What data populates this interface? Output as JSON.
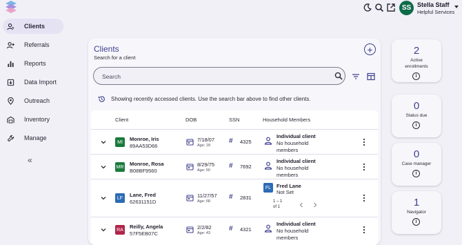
{
  "user": {
    "initials": "SS",
    "name": "Stella Staff",
    "org": "Helpful Services"
  },
  "sidebar": {
    "items": [
      {
        "label": "Clients",
        "icon": "clients-icon",
        "active": true
      },
      {
        "label": "Referrals",
        "icon": "referrals-icon"
      },
      {
        "label": "Reports",
        "icon": "reports-icon"
      },
      {
        "label": "Data Import",
        "icon": "data-import-icon"
      },
      {
        "label": "Outreach",
        "icon": "outreach-icon"
      },
      {
        "label": "Inventory",
        "icon": "inventory-icon"
      },
      {
        "label": "Manage",
        "icon": "manage-icon"
      }
    ],
    "collapse_glyph": "«"
  },
  "main": {
    "title": "Clients",
    "subtitle": "Search for a client",
    "search_placeholder": "Search",
    "notice": "Showing recently accessed clients. Use the search bar above to find other clients.",
    "columns": [
      "Client",
      "DOB",
      "SSN",
      "Household Members"
    ],
    "rows": [
      {
        "initials": "MI",
        "avatar_color": "#1a7a3c",
        "name": "Monroe, Iris",
        "id": "89AA53D66",
        "dob": "7/18/07",
        "age": "Age: 18",
        "ssn": "4325",
        "hh_title": "Individual client",
        "hh_sub1": "No household",
        "hh_sub2": "members"
      },
      {
        "initials": "MR",
        "avatar_color": "#1a7a3c",
        "name": "Monroe, Rosa",
        "id": "B08BF9560",
        "dob": "8/29/75",
        "age": "Age: 50",
        "ssn": "7692",
        "hh_title": "Individual client",
        "hh_sub1": "No household",
        "hh_sub2": "members"
      },
      {
        "initials": "LF",
        "avatar_color": "#2d6bb5",
        "name": "Lane, Fred",
        "id": "62631151D",
        "dob": "11/27/57",
        "age": "Age: 68",
        "ssn": "2831",
        "hh_initials": "FL",
        "hh_title": "Fred Lane",
        "hh_sub1": "Not Set",
        "pager": "1 – 1",
        "pager2": "of 1"
      },
      {
        "initials": "RA",
        "avatar_color": "#b0244a",
        "name": "Reilly, Angela",
        "id": "57F5EB07C",
        "dob": "2/2/82",
        "age": "Age: 43",
        "ssn": "4321",
        "hh_title": "Individual client",
        "hh_sub1": "No household",
        "hh_sub2": "members"
      }
    ]
  },
  "stats": [
    {
      "value": "2",
      "label1": "Active",
      "label2": "enrollments"
    },
    {
      "value": "0",
      "label1": "Status due",
      "label2": ""
    },
    {
      "value": "0",
      "label1": "Case manager",
      "label2": ""
    },
    {
      "value": "1",
      "label1": "Navigator",
      "label2": ""
    }
  ],
  "icons": [
    "logo-icon",
    "dark-mode-icon",
    "search-icon",
    "external-link-icon",
    "filter-icon",
    "columns-icon",
    "history-icon",
    "calendar-icon",
    "hash-icon",
    "person-icon",
    "kebab-icon",
    "chevron-down-icon",
    "info-icon"
  ],
  "colors": {
    "accent": "#3e3f8f",
    "background": "#f1f0f7",
    "active_nav": "#e4e2f3"
  }
}
